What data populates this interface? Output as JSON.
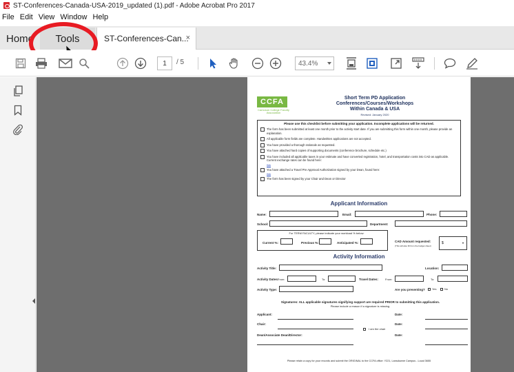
{
  "window": {
    "title": "ST-Conferences-Canada-USA-2019_updated (1).pdf - Adobe Acrobat Pro 2017"
  },
  "menu": {
    "items": [
      "File",
      "Edit",
      "View",
      "Window",
      "Help"
    ]
  },
  "tabs": {
    "home": "Home",
    "tools": "Tools",
    "document": "ST-Conferences-Can...",
    "close": "×"
  },
  "toolbar": {
    "page_current": "1",
    "page_total": "/ 5",
    "zoom": "43.4%"
  },
  "icons": [
    "save-icon",
    "print-icon",
    "email-icon",
    "search-icon",
    "page-up-icon",
    "page-down-icon",
    "select-arrow-icon",
    "hand-icon",
    "zoom-out-icon",
    "zoom-in-icon",
    "fit-page-icon",
    "scroll-mode-icon",
    "fullscreen-icon",
    "read-mode-icon",
    "comment-icon",
    "pen-icon",
    "pages-panel-icon",
    "bookmark-icon",
    "attachment-icon"
  ],
  "colors": {
    "annotation_circle": "#e81b23",
    "logo_green": "#79b843",
    "heading_navy": "#1a2d5a"
  },
  "document": {
    "logo_text": "CCFA",
    "logo_sub": "Camosun College Faculty Association",
    "heading_1": "Short Term PD Application",
    "heading_2": "Conferences/Courses/Workshops",
    "heading_3": "Within Canada & USA",
    "heading_rev": "Revised: January 2020",
    "checklist_title": "Please use this checklist before submitting your application. Incomplete applications will be returned.",
    "checklist": [
      "The form has been submitted at least one month prior to the activity start date. If you are submitting this form within one month, please provide an explanation.",
      "All applicable form fields are complete. Handwritten applications are not accepted.",
      "You have provided a thorough rationale as requested.",
      "You have attached hard copies of supporting documents (conference brochure, schedule etc.)",
      "You have included all applicable taxes in your estimate and have converted registration, hotel, and transportation costs into CAD as applicable. Current exchange rates can be found here:",
      "You have attached a Travel Pre Approval Authorization signed by your Dean, found here:",
      "The form has been signed by your Chair and Dean or Director"
    ],
    "link_text": "link",
    "applicant_title": "Applicant Information",
    "name_label": "Name:",
    "email_label": "Email:",
    "phone_label": "Phone:",
    "school_label": "School:",
    "department_label": "Department:",
    "term_faculty_text": "For TERM FACULTY, please indicate your workload % below:",
    "current_label": "Current %:",
    "previous_label": "Previous %:",
    "anticipated_label": "Anticipated %:",
    "cad_label": "CAD Amount requested:",
    "cad_sub": "(This will also fill from the budget sheet)",
    "cad_value": "$",
    "activity_title": "Activity Information",
    "activity_title_label": "Activity Title:",
    "location_label": "Location:",
    "activity_dates_label": "Activity Dates:",
    "from_label": "From:",
    "to_label": "To:",
    "travel_dates_label": "Travel Dates:",
    "activity_type_label": "Activity Type:",
    "presenting_label": "Are you presenting?",
    "yes_label": "Yes",
    "no_label": "No",
    "signatures_text": "Signatures: ALL applicable signatures signifying support are required PRIOR to submitting this application.",
    "signatures_sub": "Please include a reason if a signature is missing.",
    "applicant_label": "Applicant:",
    "date_label": "Date:",
    "chair_label": "Chair:",
    "i_am_chair": "I am the chair",
    "dean_label": "Dean/Associate Dean/Director:",
    "footer": "Please retain a copy for your records and submit the ORIGINAL to the CCFA office: Y221, Lansdowne Campus - Local 3655"
  }
}
